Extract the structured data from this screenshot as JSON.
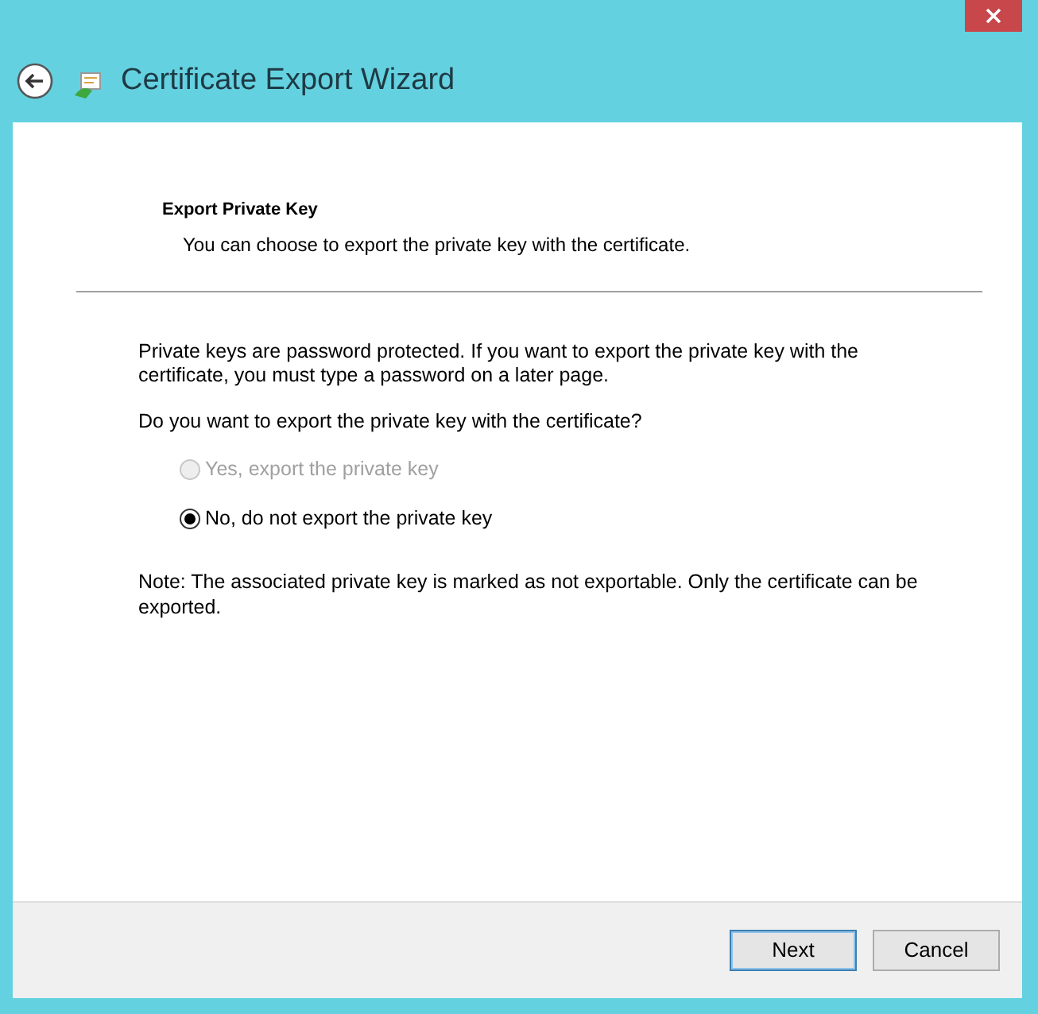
{
  "window": {
    "title": "Certificate Export Wizard"
  },
  "page": {
    "heading": "Export Private Key",
    "subheading": "You can choose to export the private key with the certificate."
  },
  "body": {
    "intro": "Private keys are password protected. If you want to export the private key with the certificate, you must type a password on a later page.",
    "question": "Do you want to export the private key with the certificate?",
    "options": [
      {
        "label": "Yes, export the private key",
        "selected": false,
        "disabled": true
      },
      {
        "label": "No, do not export the private key",
        "selected": true,
        "disabled": false
      }
    ],
    "note": "Note: The associated private key is marked as not exportable. Only the certificate can be exported."
  },
  "buttons": [
    {
      "label": "Next",
      "default": true
    },
    {
      "label": "Cancel",
      "default": false
    }
  ]
}
